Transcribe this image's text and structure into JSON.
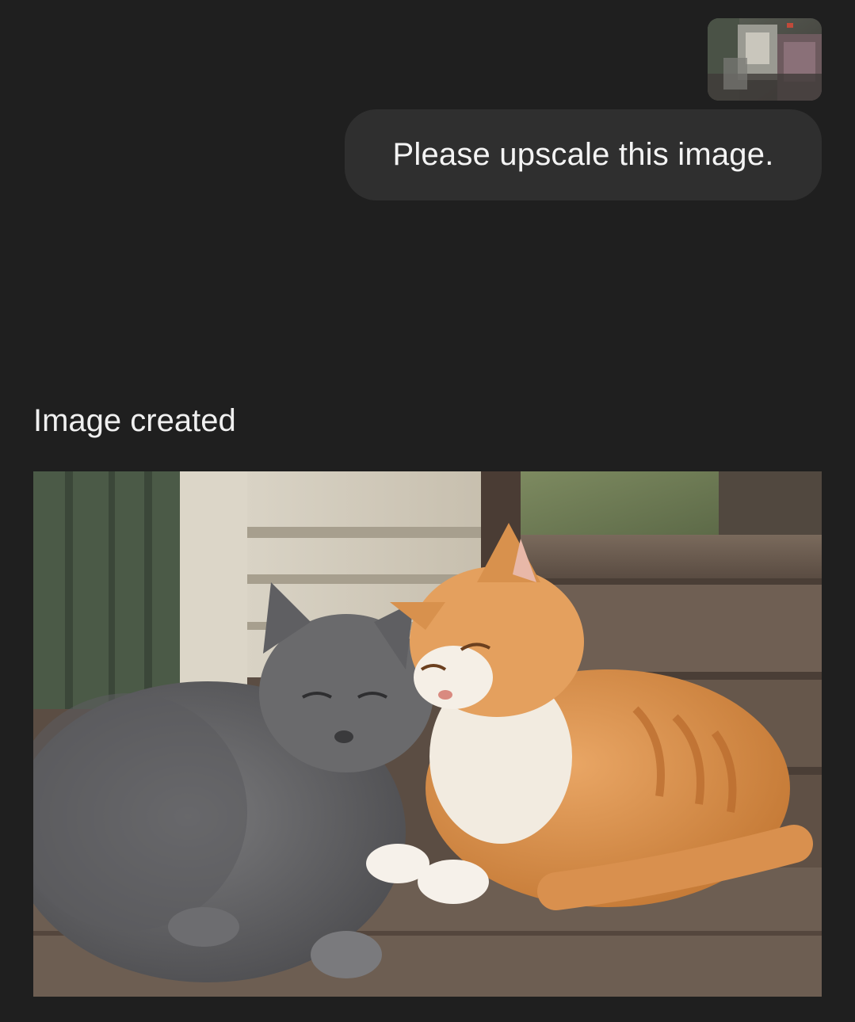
{
  "conversation": {
    "user_message": {
      "attachment": {
        "kind": "image",
        "icon": "photo-thumbnail"
      },
      "text": "Please upscale this image."
    },
    "assistant_message": {
      "status_text": "Image created",
      "image": {
        "kind": "generated-image",
        "subject": "grey cat and orange tabby cat cuddling on wooden porch steps"
      }
    }
  },
  "theme": {
    "background": "#1f1f1f",
    "bubble": "#2f2f2f",
    "text": "#f4f4f4"
  }
}
